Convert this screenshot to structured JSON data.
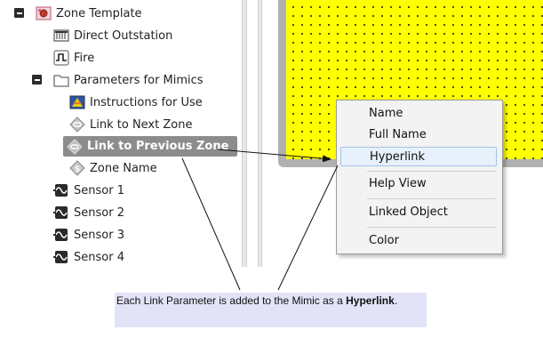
{
  "tree": {
    "items": [
      {
        "label": "Zone Template",
        "icon": "zone-template-icon"
      },
      {
        "label": "Direct Outstation",
        "icon": "outstation-icon"
      },
      {
        "label": "Fire",
        "icon": "fire-pulse-icon"
      },
      {
        "label": "Parameters for Mimics",
        "icon": "folder-icon"
      },
      {
        "label": "Instructions for Use",
        "icon": "instructions-icon"
      },
      {
        "label": "Link to Next Zone",
        "icon": "link-icon"
      },
      {
        "label": "Link to Previous Zone",
        "icon": "link-icon",
        "selected": true
      },
      {
        "label": "Zone Name",
        "icon": "string-param-icon"
      },
      {
        "label": "Sensor 1",
        "icon": "sensor-icon"
      },
      {
        "label": "Sensor 2",
        "icon": "sensor-icon"
      },
      {
        "label": "Sensor 3",
        "icon": "sensor-icon"
      },
      {
        "label": "Sensor 4",
        "icon": "sensor-icon"
      }
    ]
  },
  "context_menu": {
    "items": [
      "Name",
      "Full Name",
      "Hyperlink",
      "Help View",
      "Linked Object",
      "Color"
    ],
    "highlighted": "Hyperlink"
  },
  "callout": {
    "text_before": "Each Link Parameter is added to the Mimic as a ",
    "text_bold": "Hyperlink",
    "text_after": "."
  },
  "colors": {
    "canvas": "#ffff00",
    "selection": "#8c8c8c",
    "callout_bg": "#e3e3f8"
  }
}
